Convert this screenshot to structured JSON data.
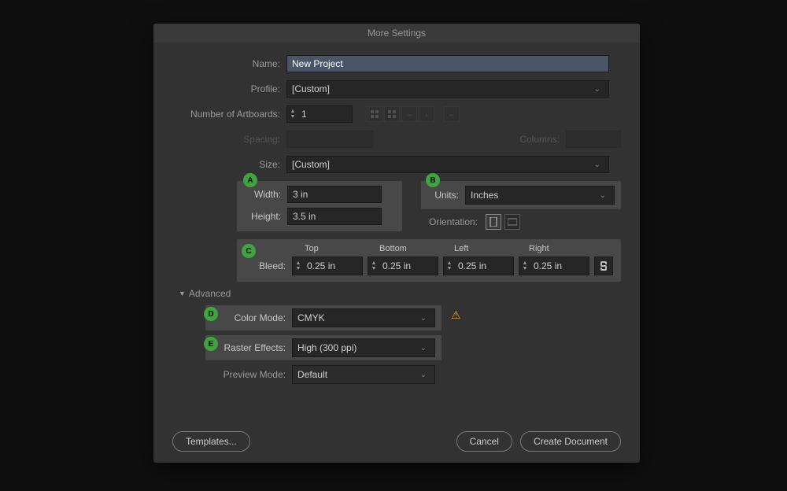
{
  "dialog": {
    "title": "More Settings"
  },
  "name": {
    "label": "Name:",
    "value": "New Project"
  },
  "profile": {
    "label": "Profile:",
    "value": "[Custom]"
  },
  "artboards": {
    "label": "Number of Artboards:",
    "value": "1",
    "spacing_label": "Spacing:",
    "columns_label": "Columns:"
  },
  "size": {
    "label": "Size:",
    "value": "[Custom]"
  },
  "badges": {
    "a": "A",
    "b": "B",
    "c": "C",
    "d": "D",
    "e": "E"
  },
  "dimensions": {
    "width_label": "Width:",
    "width_value": "3 in",
    "height_label": "Height:",
    "height_value": "3.5 in"
  },
  "units": {
    "label": "Units:",
    "value": "Inches"
  },
  "orientation": {
    "label": "Orientation:"
  },
  "bleed": {
    "label": "Bleed:",
    "top_label": "Top",
    "bottom_label": "Bottom",
    "left_label": "Left",
    "right_label": "Right",
    "top": "0.25 in",
    "bottom": "0.25 in",
    "left": "0.25 in",
    "right": "0.25 in"
  },
  "advanced": {
    "header": "Advanced",
    "color_mode_label": "Color Mode:",
    "color_mode_value": "CMYK",
    "raster_label": "Raster Effects:",
    "raster_value": "High (300 ppi)",
    "preview_label": "Preview Mode:",
    "preview_value": "Default"
  },
  "footer": {
    "templates": "Templates...",
    "cancel": "Cancel",
    "create": "Create Document"
  }
}
